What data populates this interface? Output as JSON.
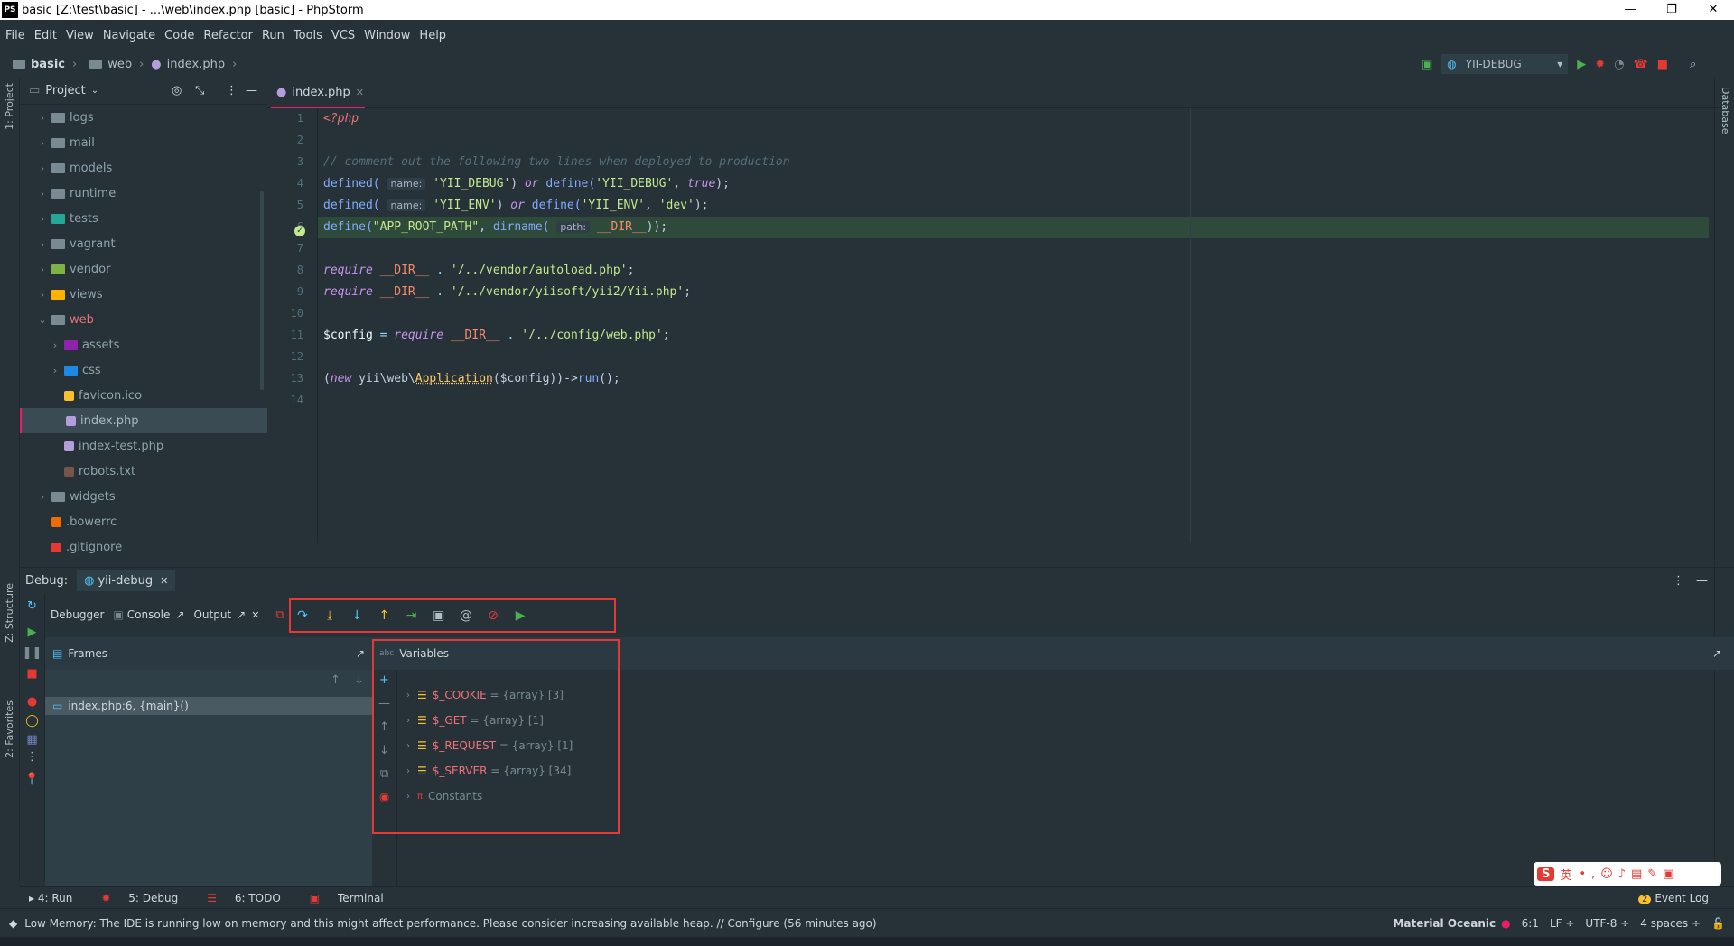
{
  "window": {
    "title": "basic [Z:\\test\\basic] - ...\\web\\index.php [basic] - PhpStorm",
    "logo": "PS",
    "minimize": "—",
    "maximize": "❐",
    "close": "✕"
  },
  "menu": [
    "File",
    "Edit",
    "View",
    "Navigate",
    "Code",
    "Refactor",
    "Run",
    "Tools",
    "VCS",
    "Window",
    "Help"
  ],
  "breadcrumb": {
    "project": "basic",
    "folder": "web",
    "file": "index.php"
  },
  "run_config": "YII-DEBUG",
  "project_panel": {
    "title": "Project",
    "strip_label": "1: Project",
    "items": [
      {
        "label": "logs",
        "type": "folder",
        "depth": 1,
        "color": "#7a8a93",
        "chev": "›"
      },
      {
        "label": "mail",
        "type": "folder",
        "depth": 1,
        "color": "#7a8a93",
        "chev": "›"
      },
      {
        "label": "models",
        "type": "folder",
        "depth": 1,
        "color": "#7a8a93",
        "chev": "›"
      },
      {
        "label": "runtime",
        "type": "folder",
        "depth": 1,
        "color": "#7a8a93",
        "chev": "›"
      },
      {
        "label": "tests",
        "type": "folder",
        "depth": 1,
        "color": "#26a69a",
        "chev": "›"
      },
      {
        "label": "vagrant",
        "type": "folder",
        "depth": 1,
        "color": "#7a8a93",
        "chev": "›"
      },
      {
        "label": "vendor",
        "type": "folder",
        "depth": 1,
        "color": "#7cb342",
        "chev": "›"
      },
      {
        "label": "views",
        "type": "folder",
        "depth": 1,
        "color": "#ffb300",
        "chev": "›"
      },
      {
        "label": "web",
        "type": "folder-open",
        "depth": 1,
        "color": "#7a8a93",
        "chev": "⌄"
      },
      {
        "label": "assets",
        "type": "folder",
        "depth": 2,
        "color": "#8e24aa",
        "chev": "›"
      },
      {
        "label": "css",
        "type": "folder",
        "depth": 2,
        "color": "#1e88e5",
        "chev": "›"
      },
      {
        "label": "favicon.ico",
        "type": "file",
        "depth": 2,
        "color": "#fbc02d",
        "chev": ""
      },
      {
        "label": "index.php",
        "type": "file",
        "depth": 2,
        "color": "#b39ddb",
        "chev": ""
      },
      {
        "label": "index-test.php",
        "type": "file",
        "depth": 2,
        "color": "#b39ddb",
        "chev": ""
      },
      {
        "label": "robots.txt",
        "type": "file",
        "depth": 2,
        "color": "#795548",
        "chev": ""
      },
      {
        "label": "widgets",
        "type": "folder",
        "depth": 1,
        "color": "#7a8a93",
        "chev": "›"
      },
      {
        "label": ".bowerrc",
        "type": "file",
        "depth": 1,
        "color": "#ef6c00",
        "chev": ""
      },
      {
        "label": ".gitignore",
        "type": "file",
        "depth": 1,
        "color": "#e53935",
        "chev": ""
      }
    ]
  },
  "editor": {
    "tab": "index.php",
    "line_numbers": [
      "1",
      "2",
      "3",
      "4",
      "5",
      "6",
      "7",
      "8",
      "9",
      "10",
      "11",
      "12",
      "13",
      "14"
    ],
    "lines": {
      "l1": "<?php",
      "l3": "// comment out the following two lines when deployed to production",
      "l4_fn": "defined(",
      "l4_hint": "name:",
      "l4_str": "'YII_DEBUG'",
      "l4_mid": ") ",
      "l4_or": "or",
      "l4_def": " define(",
      "l4_str2": "'YII_DEBUG'",
      "l4_comma": ", ",
      "l4_true": "true",
      "l4_end": ");",
      "l5_fn": "defined(",
      "l5_hint": "name:",
      "l5_str": "'YII_ENV'",
      "l5_mid": ") ",
      "l5_or": "or",
      "l5_def": " define(",
      "l5_str2": "'YII_ENV'",
      "l5_comma": ", ",
      "l5_str3": "'dev'",
      "l5_end": ");",
      "l6_def": "define(",
      "l6_str": "\"APP_ROOT_PATH\"",
      "l6_comma": ", ",
      "l6_fn": "dirname(",
      "l6_hint": "path:",
      "l6_const": "__DIR__",
      "l6_end": "));",
      "l8_req": "require",
      "l8_const": " __DIR__",
      "l8_dot": " . ",
      "l8_str": "'/../vendor/autoload.php'",
      "l8_end": ";",
      "l9_req": "require",
      "l9_const": " __DIR__",
      "l9_dot": " . ",
      "l9_str": "'/../vendor/yiisoft/yii2/Yii.php'",
      "l9_end": ";",
      "l11_var": "$config",
      "l11_eq": " = ",
      "l11_req": "require",
      "l11_const": " __DIR__",
      "l11_dot": " . ",
      "l11_str": "'/../config/web.php'",
      "l11_end": ";",
      "l13_open": "(",
      "l13_new": "new",
      "l13_ns": " yii\\web\\",
      "l13_cls": "Application",
      "l13_args": "($config))->",
      "l13_run": "run",
      "l13_end": "();"
    }
  },
  "debug": {
    "label": "Debug:",
    "session": "yii-debug",
    "tabs": {
      "debugger": "Debugger",
      "console": "Console",
      "output": "Output"
    },
    "frames_title": "Frames",
    "frame": "index.php:6, {main}()",
    "variables_title": "Variables",
    "variables": [
      {
        "name": "$_COOKIE",
        "value": "= {array} [3]"
      },
      {
        "name": "$_GET",
        "value": "= {array} [1]"
      },
      {
        "name": "$_REQUEST",
        "value": "= {array} [1]"
      },
      {
        "name": "$_SERVER",
        "value": "= {array} [34]"
      }
    ],
    "constants": "Constants"
  },
  "left_strip": {
    "structure": "Z: Structure",
    "favorites": "2: Favorites"
  },
  "right_strip": {
    "database": "Database"
  },
  "bottom_tools": {
    "run": "4: Run",
    "debug": "5: Debug",
    "todo": "6: TODO",
    "terminal": "Terminal",
    "event_log": "Event Log",
    "event_count": "2"
  },
  "status": {
    "message": "Low Memory: The IDE is running low on memory and this might affect performance. Please consider increasing available heap. // Configure (56 minutes ago)",
    "theme": "Material Oceanic",
    "position": "6:1",
    "line_sep": "LF ÷",
    "encoding": "UTF-8 ÷",
    "indent": "4 spaces ÷"
  },
  "ime": {
    "logo": "S",
    "lang": "英"
  },
  "accent_color": "#e91e63",
  "highlight_color": "#e53935"
}
